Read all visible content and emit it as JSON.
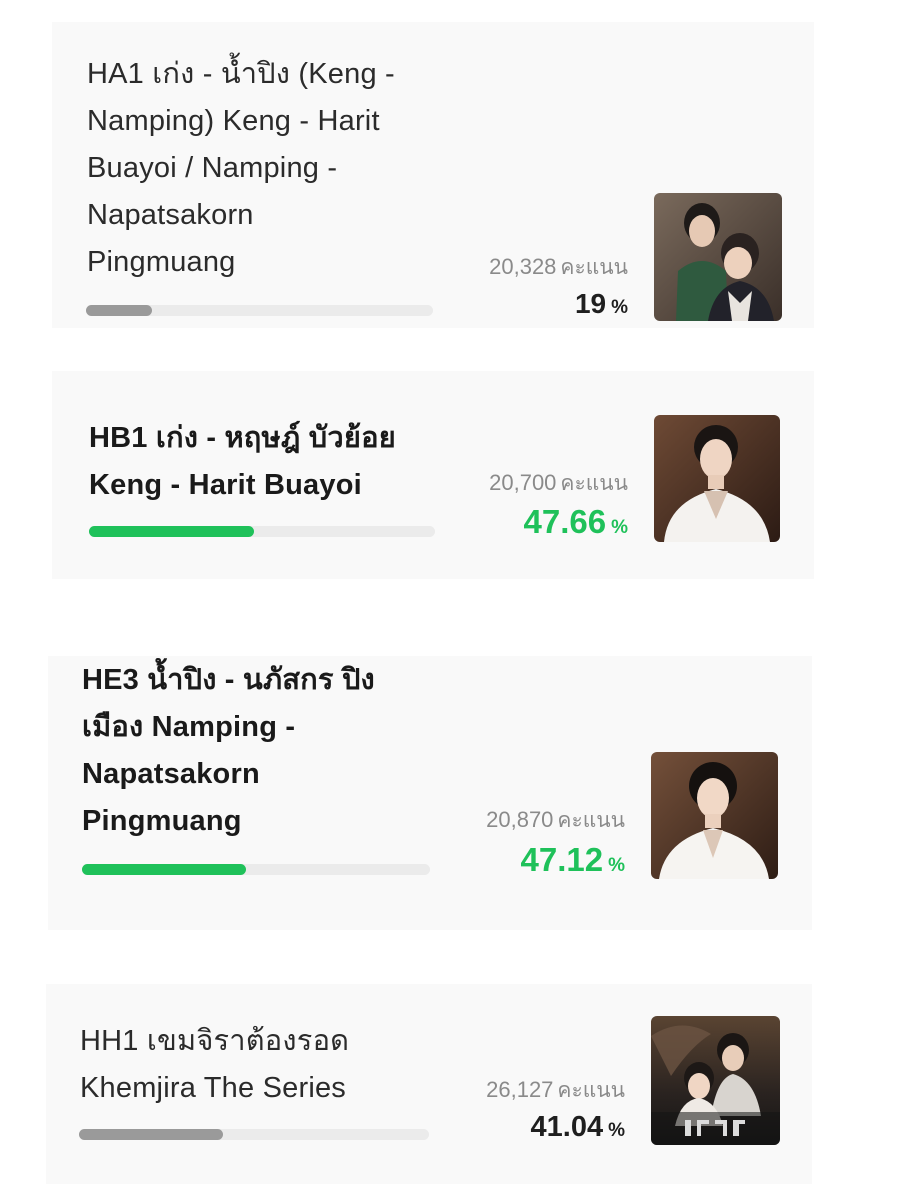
{
  "colors": {
    "leader_green": "#1fc15a",
    "bar_gray": "#9a9a9a",
    "bar_track": "#ebebeb",
    "card_bg": "#f9f9f9",
    "vote_gray": "#8a8a8a"
  },
  "candidates": [
    {
      "title_lines": [
        "HA1 เก่ง - น้ำปิง (Keng -",
        "Namping) Keng - Harit",
        "Buayoi / Namping -",
        "Napatsakorn",
        "Pingmuang"
      ],
      "votes": "20,328",
      "votes_unit": "คะแนน",
      "percent": "19",
      "percent_sign": "%",
      "bar_fraction": 0.19,
      "highlight": false,
      "image": "couple-photo"
    },
    {
      "title_lines": [
        "HB1 เก่ง - หฤษฎ์ บัวย้อย",
        "Keng - Harit Buayoi"
      ],
      "votes": "20,700",
      "votes_unit": "คะแนน",
      "percent": "47.66",
      "percent_sign": "%",
      "bar_fraction": 0.4766,
      "highlight": true,
      "image": "portrait-photo"
    },
    {
      "title_lines": [
        "HE3 น้ำปิง - นภัสกร ปิง",
        "เมือง Namping -",
        "Napatsakorn",
        "Pingmuang"
      ],
      "votes": "20,870",
      "votes_unit": "คะแนน",
      "percent": "47.12",
      "percent_sign": "%",
      "bar_fraction": 0.4712,
      "highlight": true,
      "image": "portrait-photo"
    },
    {
      "title_lines": [
        "HH1 เขมจิราต้องรอด",
        "Khemjira The Series"
      ],
      "votes": "26,127",
      "votes_unit": "คะแนน",
      "percent": "41.04",
      "percent_sign": "%",
      "bar_fraction": 0.4104,
      "highlight": false,
      "image": "series-poster"
    }
  ]
}
